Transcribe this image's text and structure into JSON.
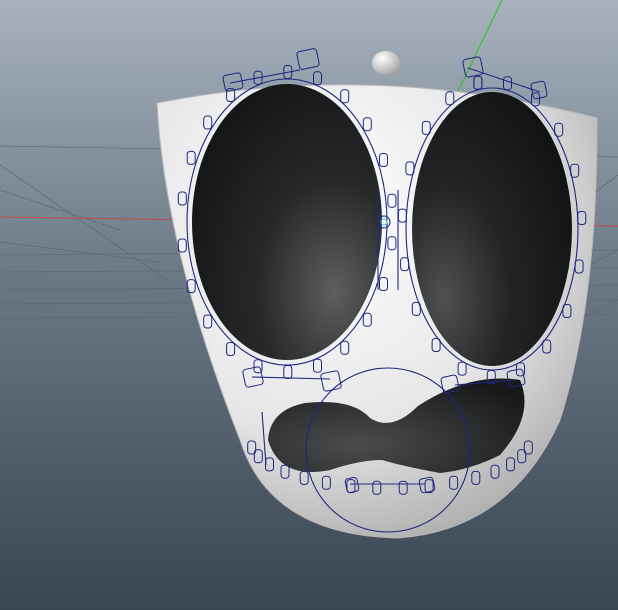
{
  "viewport": {
    "background_top": "#a7b2bd",
    "background_bottom": "#3a4552",
    "grid_color": "#5d6773",
    "axis_x_color": "#c14a4a",
    "axis_y_color": "#34c534"
  },
  "model": {
    "shell_color": "#e7e7e7",
    "eye_color": "#1a1c1e",
    "mouth_color": "#222426",
    "control_curve_color": "#1f2680"
  }
}
